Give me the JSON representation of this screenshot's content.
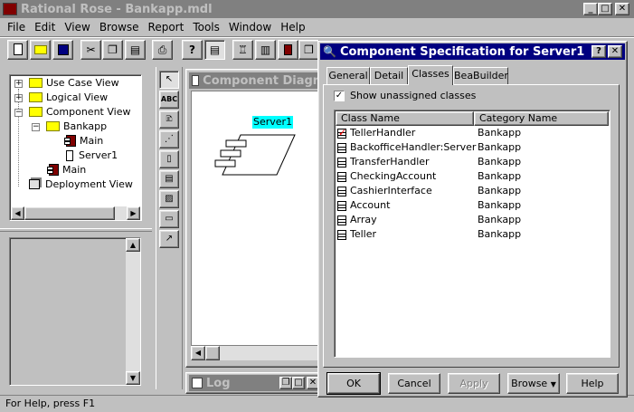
{
  "app": {
    "title": "Rational Rose - Bankapp.mdl",
    "menu": [
      "File",
      "Edit",
      "View",
      "Browse",
      "Report",
      "Tools",
      "Window",
      "Help"
    ]
  },
  "toolbar": {
    "help_glyph": "?",
    "new_icon": "new-document-icon",
    "open_icon": "open-folder-icon",
    "save_icon": "save-disk-icon"
  },
  "browser": {
    "items": [
      {
        "label": "Use Case View"
      },
      {
        "label": "Logical View"
      },
      {
        "label": "Component View"
      },
      {
        "label": "Bankapp"
      },
      {
        "label": "Main"
      },
      {
        "label": "Server1"
      },
      {
        "label": "Main"
      },
      {
        "label": "Deployment View"
      }
    ]
  },
  "palette": {
    "text_tool": "ABC"
  },
  "diagram": {
    "title": "Component Diagra",
    "component_label": "Server1"
  },
  "log": {
    "title": "Log"
  },
  "status": {
    "text": "For Help, press F1"
  },
  "dialog": {
    "title": "Component Specification for Server1",
    "help_button": "?",
    "tabs": [
      "General",
      "Detail",
      "Classes",
      "BeaBuilder"
    ],
    "active_tab": "Classes",
    "show_unassigned_label": "Show unassigned classes",
    "show_unassigned_checked": true,
    "columns": [
      "Class Name",
      "Category Name"
    ],
    "rows": [
      {
        "name": "TellerHandler",
        "category": "Bankapp",
        "selected": true
      },
      {
        "name": "BackofficeHandler:Server",
        "category": "Bankapp"
      },
      {
        "name": "TransferHandler",
        "category": "Bankapp"
      },
      {
        "name": "CheckingAccount",
        "category": "Bankapp"
      },
      {
        "name": "CashierInterface",
        "category": "Bankapp"
      },
      {
        "name": "Account",
        "category": "Bankapp"
      },
      {
        "name": "Array",
        "category": "Bankapp"
      },
      {
        "name": "Teller",
        "category": "Bankapp"
      }
    ],
    "buttons": {
      "ok": "OK",
      "cancel": "Cancel",
      "apply": "Apply",
      "browse": "Browse",
      "help": "Help"
    }
  },
  "colors": {
    "active_title": "#000080",
    "inactive_title": "#808080",
    "face": "#c0c0c0",
    "component_highlight": "#00ffff"
  }
}
